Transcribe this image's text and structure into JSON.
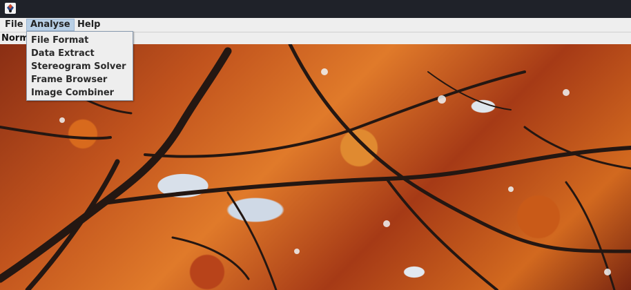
{
  "menubar": {
    "file": "File",
    "analyse": "Analyse",
    "help": "Help"
  },
  "toolbar": {
    "mode_label": "Norm"
  },
  "analyse_menu": {
    "items": [
      {
        "label": "File Format"
      },
      {
        "label": "Data Extract"
      },
      {
        "label": "Stereogram Solver"
      },
      {
        "label": "Frame Browser"
      },
      {
        "label": "Image Combiner"
      }
    ]
  },
  "colors": {
    "menu_highlight": "#b8cfe5",
    "titlebar": "#1f2229",
    "menubar": "#eeeeee"
  },
  "image": {
    "subject": "autumn-maple-leaves-photo"
  }
}
